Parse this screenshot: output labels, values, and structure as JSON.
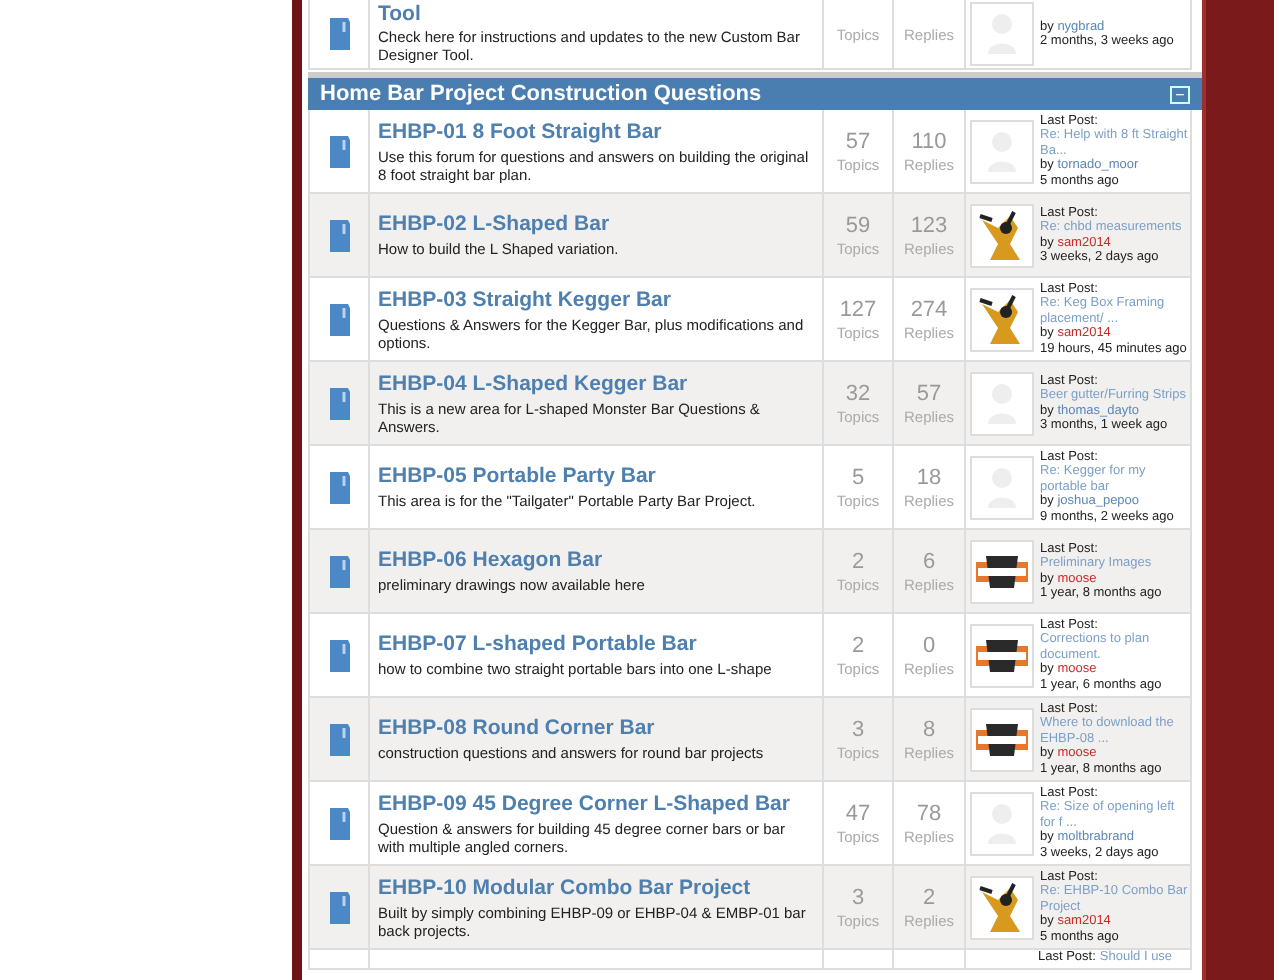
{
  "top_row": {
    "title": "Tool",
    "description": "Check here for instructions and updates to the new Custom Bar Designer Tool.",
    "topics_label": "Topics",
    "replies_label": "Replies",
    "last_post": {
      "by": "by",
      "user": "nygbrad",
      "color": "#5b86b8",
      "time": "2 months, 3 weeks ago"
    },
    "avatar": {
      "kind": "blank"
    }
  },
  "section": {
    "title": "Home Bar Project Construction Questions",
    "collapse": "−"
  },
  "forums": [
    {
      "title": "EHBP-01 8 Foot Straight Bar",
      "description": "Use this forum for questions and answers on building the original 8 foot straight bar plan.",
      "topics": "57",
      "topics_label": "Topics",
      "replies": "110",
      "replies_label": "Replies",
      "avatar": {
        "kind": "blank"
      },
      "last_post": {
        "label": "Last Post:",
        "link": "Re: Help with 8 ft Straight Ba...",
        "by": "by",
        "user": "tornado_moor",
        "color": "#5b86b8",
        "time": "5 months ago"
      }
    },
    {
      "title": "EHBP-02 L-Shaped Bar",
      "description": "How to build the L Shaped variation.",
      "topics": "59",
      "topics_label": "Topics",
      "replies": "123",
      "replies_label": "Replies",
      "avatar": {
        "kind": "cartoon"
      },
      "last_post": {
        "label": "Last Post:",
        "link": "Re: chbd measurements",
        "by": "by",
        "user": "sam2014",
        "color": "#cc2a2a",
        "time": "3 weeks, 2 days ago"
      }
    },
    {
      "title": "EHBP-03 Straight Kegger Bar",
      "description": "Questions & Answers for the Kegger Bar, plus modifications and options.",
      "topics": "127",
      "topics_label": "Topics",
      "replies": "274",
      "replies_label": "Replies",
      "avatar": {
        "kind": "cartoon"
      },
      "last_post": {
        "label": "Last Post:",
        "link": "Re: Keg Box Framing placement/ ...",
        "by": "by",
        "user": "sam2014",
        "color": "#cc2a2a",
        "time": "19 hours, 45 minutes ago"
      }
    },
    {
      "title": "EHBP-04 L-Shaped Kegger Bar",
      "description": "This is a new area for L-shaped Monster Bar Questions & Answers.",
      "topics": "32",
      "topics_label": "Topics",
      "replies": "57",
      "replies_label": "Replies",
      "avatar": {
        "kind": "blank"
      },
      "last_post": {
        "label": "Last Post:",
        "link": "Beer gutter/Furring Strips",
        "by": "by",
        "user": "thomas_dayto",
        "color": "#5b86b8",
        "time": "3 months, 1 week ago"
      }
    },
    {
      "title": "EHBP-05 Portable Party Bar",
      "description": "This area is for the \"Tailgater\" Portable Party Bar Project.",
      "topics": "5",
      "topics_label": "Topics",
      "replies": "18",
      "replies_label": "Replies",
      "avatar": {
        "kind": "blank"
      },
      "last_post": {
        "label": "Last Post:",
        "link": "Re: Kegger for my portable bar",
        "by": "by",
        "user": "joshua_pepoo",
        "color": "#5b86b8",
        "time": "9 months, 2 weeks ago"
      }
    },
    {
      "title": "EHBP-06 Hexagon Bar",
      "description": "preliminary drawings now available here",
      "topics": "2",
      "topics_label": "Topics",
      "replies": "6",
      "replies_label": "Replies",
      "avatar": {
        "kind": "emblem"
      },
      "last_post": {
        "label": "Last Post:",
        "link": "Preliminary Images",
        "by": "by",
        "user": "moose",
        "color": "#cc2a2a",
        "time": "1 year, 8 months ago"
      }
    },
    {
      "title": "EHBP-07 L-shaped Portable Bar",
      "description": "how to combine two straight portable bars into one L-shape",
      "topics": "2",
      "topics_label": "Topics",
      "replies": "0",
      "replies_label": "Replies",
      "avatar": {
        "kind": "emblem"
      },
      "last_post": {
        "label": "Last Post:",
        "link": "Corrections to plan document.",
        "by": "by",
        "user": "moose",
        "color": "#cc2a2a",
        "time": "1 year, 6 months ago"
      }
    },
    {
      "title": "EHBP-08 Round Corner Bar",
      "description": "construction questions and answers for round bar projects",
      "topics": "3",
      "topics_label": "Topics",
      "replies": "8",
      "replies_label": "Replies",
      "avatar": {
        "kind": "emblem"
      },
      "last_post": {
        "label": "Last Post:",
        "link": "Where to download the EHBP-08 ...",
        "by": "by",
        "user": "moose",
        "color": "#cc2a2a",
        "time": "1 year, 8 months ago"
      }
    },
    {
      "title": "EHBP-09 45 Degree Corner L-Shaped Bar",
      "description": "Question & answers for building 45 degree corner bars or bar with multiple angled corners.",
      "topics": "47",
      "topics_label": "Topics",
      "replies": "78",
      "replies_label": "Replies",
      "avatar": {
        "kind": "blank"
      },
      "last_post": {
        "label": "Last Post:",
        "link": "Re: Size of opening left for f ...",
        "by": "by",
        "user": "moltbrabrand",
        "color": "#5b86b8",
        "time": "3 weeks, 2 days ago"
      }
    },
    {
      "title": "EHBP-10 Modular Combo Bar Project",
      "description": "Built by simply combining EHBP-09 or EHBP-04 & EMBP-01 bar back projects.",
      "topics": "3",
      "topics_label": "Topics",
      "replies": "2",
      "replies_label": "Replies",
      "avatar": {
        "kind": "cartoon"
      },
      "last_post": {
        "label": "Last Post:",
        "link": "Re: EHBP-10 Combo Bar Project",
        "by": "by",
        "user": "sam2014",
        "color": "#cc2a2a",
        "time": "5 months ago"
      }
    }
  ],
  "partial_row": {
    "label": "Last Post:",
    "link": "Should I use"
  }
}
